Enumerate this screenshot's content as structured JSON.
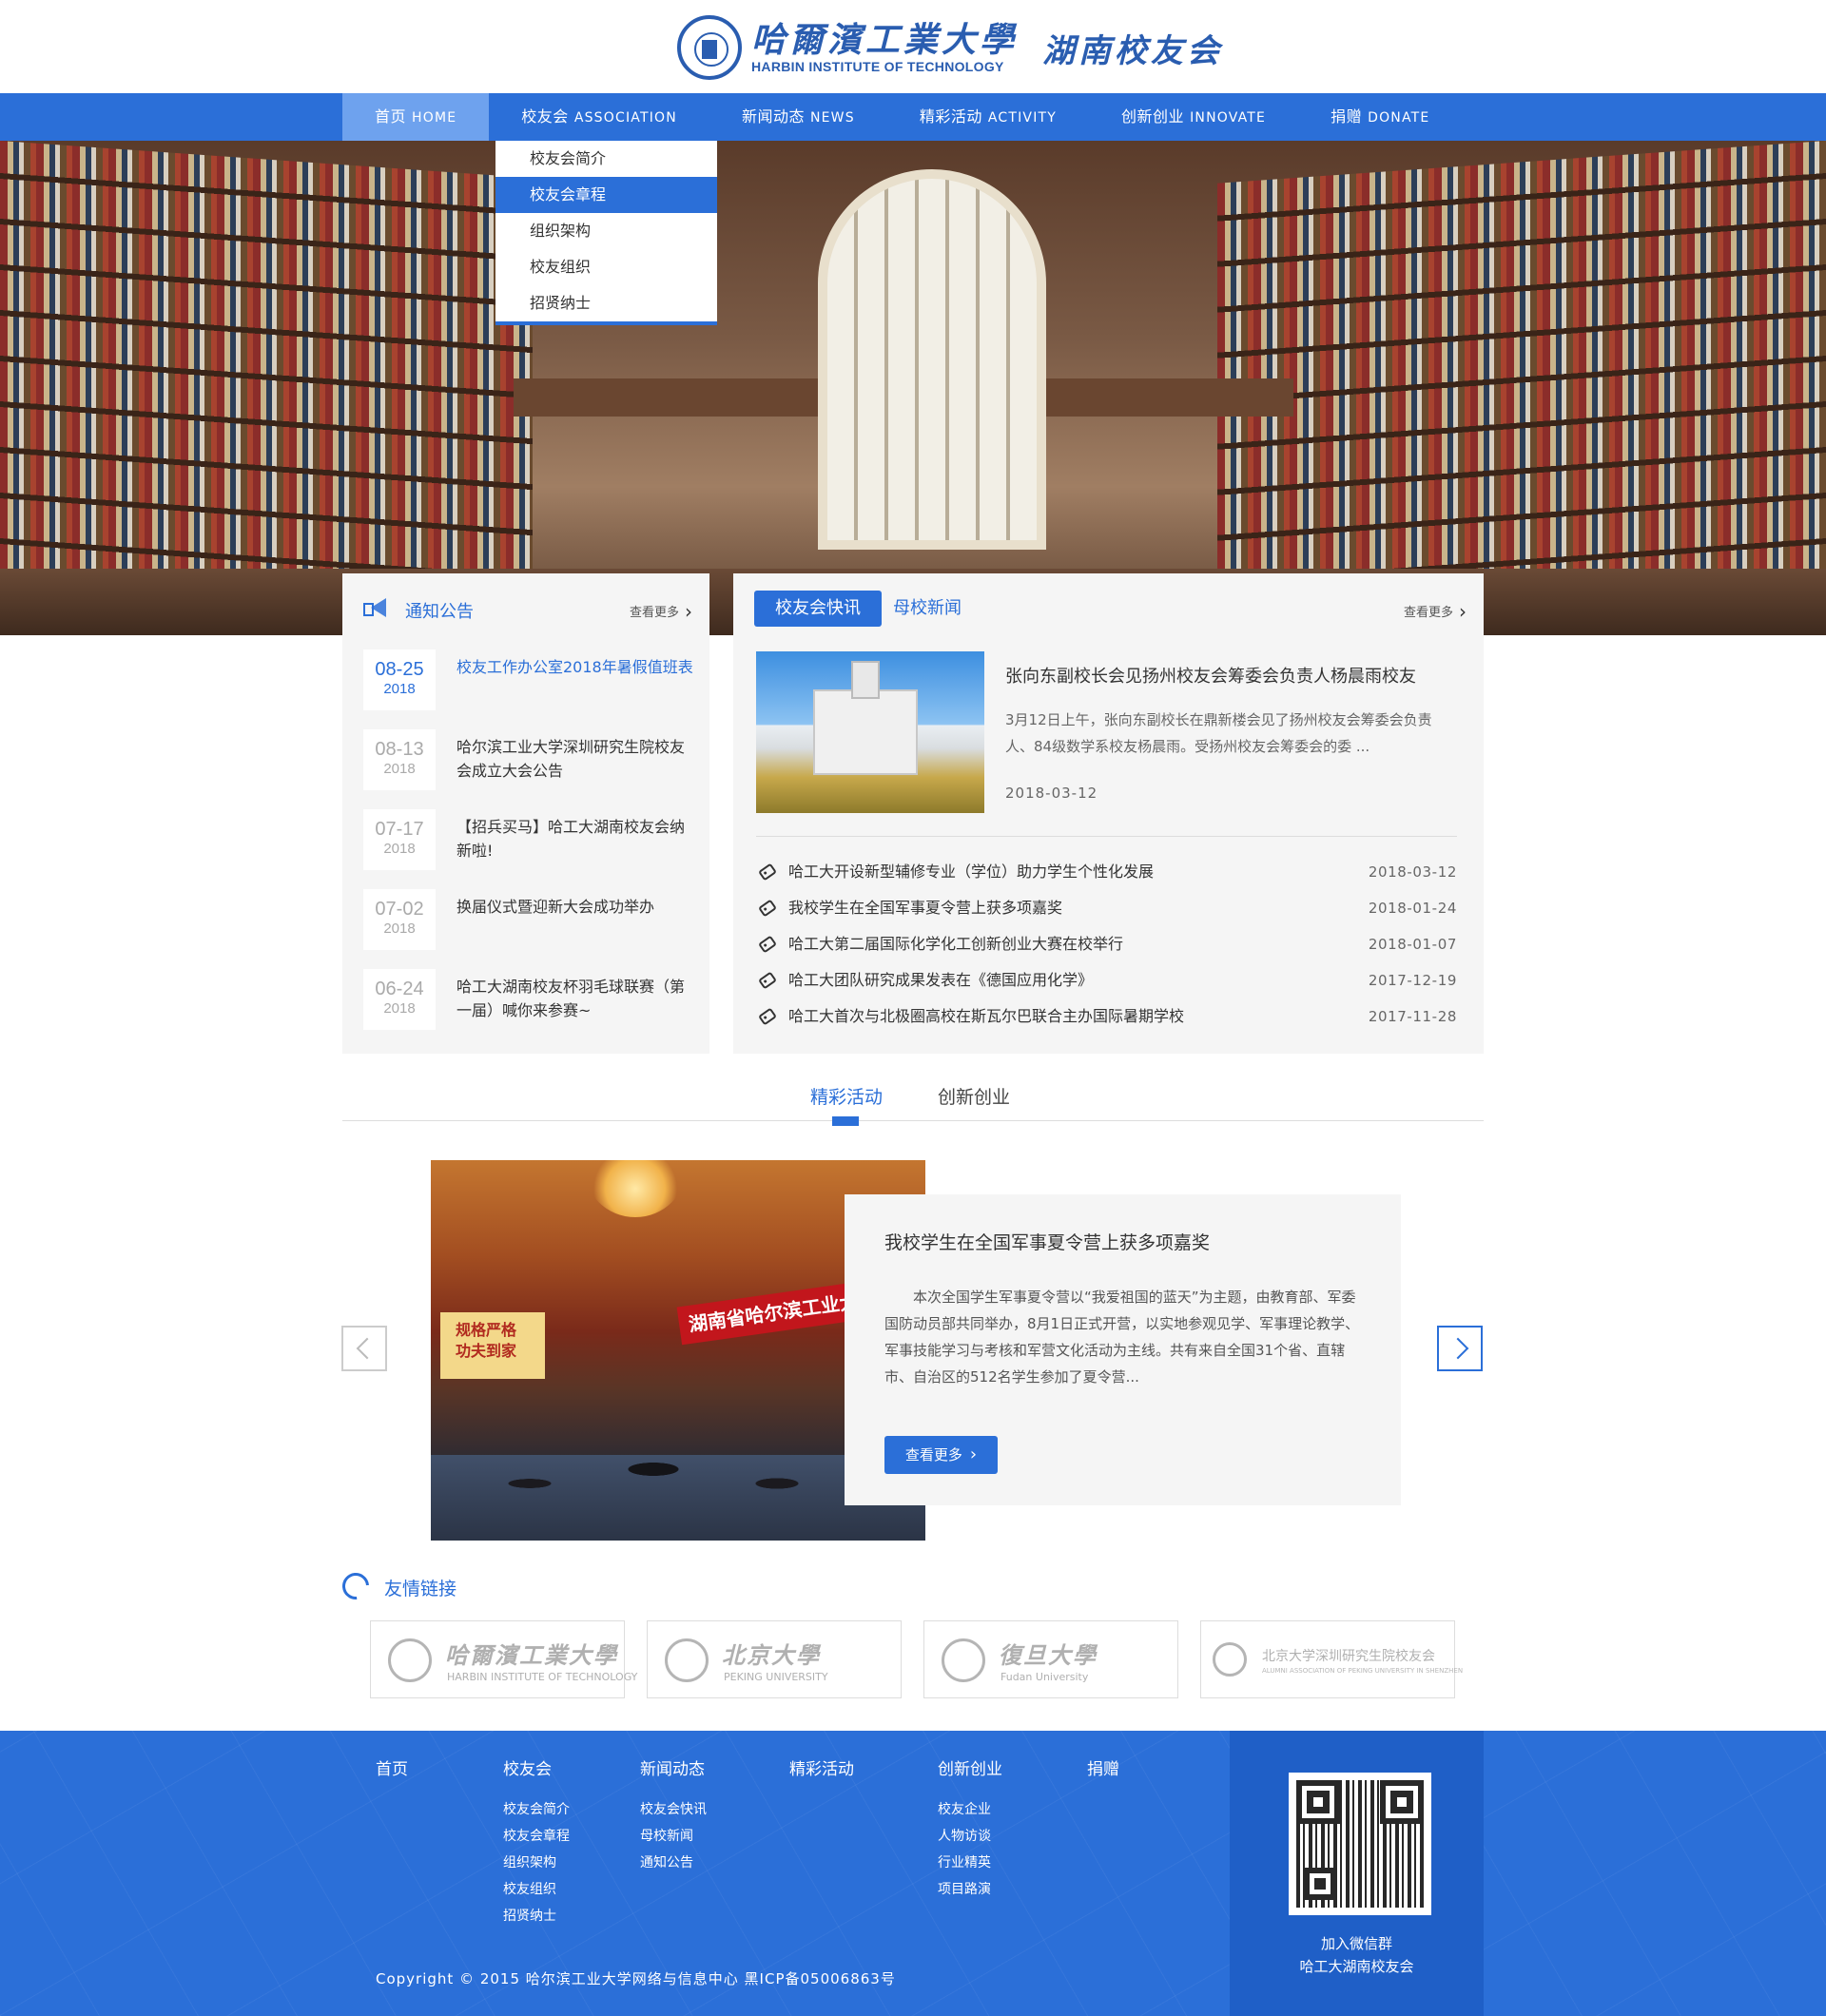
{
  "header": {
    "school_cn": "哈爾濱工業大學",
    "school_en": "HARBIN INSTITUTE OF TECHNOLOGY",
    "subtitle": "湖南校友会"
  },
  "nav": [
    {
      "cn": "首页",
      "en": "HOME",
      "active": true
    },
    {
      "cn": "校友会",
      "en": "ASSOCIATION"
    },
    {
      "cn": "新闻动态",
      "en": "NEWS"
    },
    {
      "cn": "精彩活动",
      "en": "ACTIVITY"
    },
    {
      "cn": "创新创业",
      "en": "INNOVATE"
    },
    {
      "cn": "捐赠",
      "en": "DONATE"
    }
  ],
  "dropdown": [
    "校友会简介",
    "校友会章程",
    "组织架构",
    "校友组织",
    "招贤纳士"
  ],
  "dropdown_selected": "校友会章程",
  "notice": {
    "title": "通知公告",
    "more": "查看更多",
    "items": [
      {
        "date": "08-25",
        "year": "2018",
        "text": "校友工作办公室2018年暑假值班表"
      },
      {
        "date": "08-13",
        "year": "2018",
        "text": "哈尔滨工业大学深圳研究生院校友会成立大会公告"
      },
      {
        "date": "07-17",
        "year": "2018",
        "text": "【招兵买马】哈工大湖南校友会纳新啦!"
      },
      {
        "date": "07-02",
        "year": "2018",
        "text": "换届仪式暨迎新大会成功举办"
      },
      {
        "date": "06-24",
        "year": "2018",
        "text": "哈工大湖南校友杯羽毛球联赛（第一届）喊你来参赛~"
      }
    ]
  },
  "news": {
    "tab_active": "校友会快讯",
    "tab_other": "母校新闻",
    "more": "查看更多",
    "featured": {
      "title": "张向东副校长会见扬州校友会筹委会负责人杨晨雨校友",
      "desc": "3月12日上午，张向东副校长在鼎新楼会见了扬州校友会筹委会负责人、84级数学系校友杨晨雨。受扬州校友会筹委会的委 ...",
      "date": "2018-03-12"
    },
    "list": [
      {
        "title": "哈工大开设新型辅修专业（学位）助力学生个性化发展",
        "date": "2018-03-12"
      },
      {
        "title": "我校学生在全国军事夏令营上获多项嘉奖",
        "date": "2018-01-24"
      },
      {
        "title": "哈工大第二届国际化学化工创新创业大赛在校举行",
        "date": "2018-01-07"
      },
      {
        "title": "哈工大团队研究成果发表在《德国应用化学》",
        "date": "2017-12-19"
      },
      {
        "title": "哈工大首次与北极圈高校在斯瓦尔巴联合主办国际暑期学校",
        "date": "2017-11-28"
      }
    ]
  },
  "activity": {
    "tab_active": "精彩活动",
    "tab_other": "创新创业",
    "photo_banner": "湖南省哈尔滨工业大学校友会第一",
    "photo_poster": "规格严格 功夫到家",
    "title": "我校学生在全国军事夏令营上获多项嘉奖",
    "desc": "本次全国学生军事夏令营以“我爱祖国的蓝天”为主题，由教育部、军委国防动员部共同举办，8月1日正式开营，以实地参观见学、军事理论教学、军事技能学习与考核和军营文化活动为主线。共有来自全国31个省、直辖市、自治区的512名学生参加了夏令营...",
    "button": "查看更多"
  },
  "links": {
    "title": "友情链接",
    "items": [
      {
        "name": "哈爾濱工業大學",
        "sub": "HARBIN INSTITUTE OF TECHNOLOGY"
      },
      {
        "name": "北京大學",
        "sub": "PEKING UNIVERSITY"
      },
      {
        "name": "復旦大學",
        "sub": "Fudan University"
      },
      {
        "name": "北京大学深圳研究生院校友会",
        "sub": "ALUMNI ASSOCIATION OF PEKING UNIVERSITY IN SHENZHEN"
      }
    ]
  },
  "footer": {
    "columns": [
      {
        "head": "首页",
        "links": []
      },
      {
        "head": "校友会",
        "links": [
          "校友会简介",
          "校友会章程",
          "组织架构",
          "校友组织",
          "招贤纳士"
        ]
      },
      {
        "head": "新闻动态",
        "links": [
          "校友会快讯",
          "母校新闻",
          "通知公告"
        ]
      },
      {
        "head": "精彩活动",
        "links": []
      },
      {
        "head": "创新创业",
        "links": [
          "校友企业",
          "人物访谈",
          "行业精英",
          "项目路演"
        ]
      },
      {
        "head": "捐赠",
        "links": []
      }
    ],
    "copyright": "Copyright © 2015 哈尔滨工业大学网络与信息中心 黑ICP备05006863号",
    "qr_caption1": "加入微信群",
    "qr_caption2": "哈工大湖南校友会"
  },
  "colors": {
    "primary": "#2b6fd8",
    "nav_active": "#6ea2ee",
    "footer_dark": "#1f5fc7"
  }
}
